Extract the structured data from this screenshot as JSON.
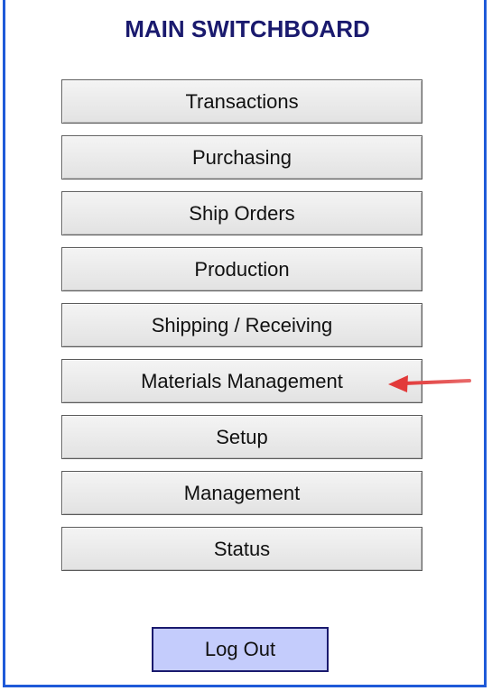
{
  "switchboard": {
    "title": "MAIN SWITCHBOARD",
    "buttons": [
      "Transactions",
      "Purchasing",
      "Ship Orders",
      "Production",
      "Shipping / Receiving",
      "Materials Management",
      "Setup",
      "Management",
      "Status"
    ],
    "logout_label": "Log Out"
  },
  "colors": {
    "border": "#1f5ad8",
    "title": "#1a1a6e",
    "logout_bg": "#c4ccfc",
    "arrow": "#e23a3a"
  },
  "annotation": {
    "points_to": "Materials Management",
    "icon": "red-arrow-icon"
  }
}
